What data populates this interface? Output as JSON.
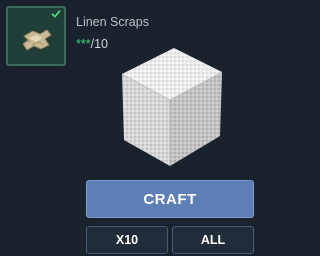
{
  "ingredient": {
    "name": "Linen Scraps",
    "count_have": "***",
    "count_need": "/10",
    "icon": "linen-scraps-icon",
    "status_icon": "checkmark-icon",
    "status_color": "#3fd17a"
  },
  "preview": {
    "icon": "linen-block-icon"
  },
  "actions": {
    "craft_label": "CRAFT",
    "x10_label": "X10",
    "all_label": "ALL"
  },
  "colors": {
    "background": "#1a222b",
    "slot_background": "#1f3e38",
    "craft_button": "#5d7fb6",
    "secondary_button": "#222d3b"
  }
}
